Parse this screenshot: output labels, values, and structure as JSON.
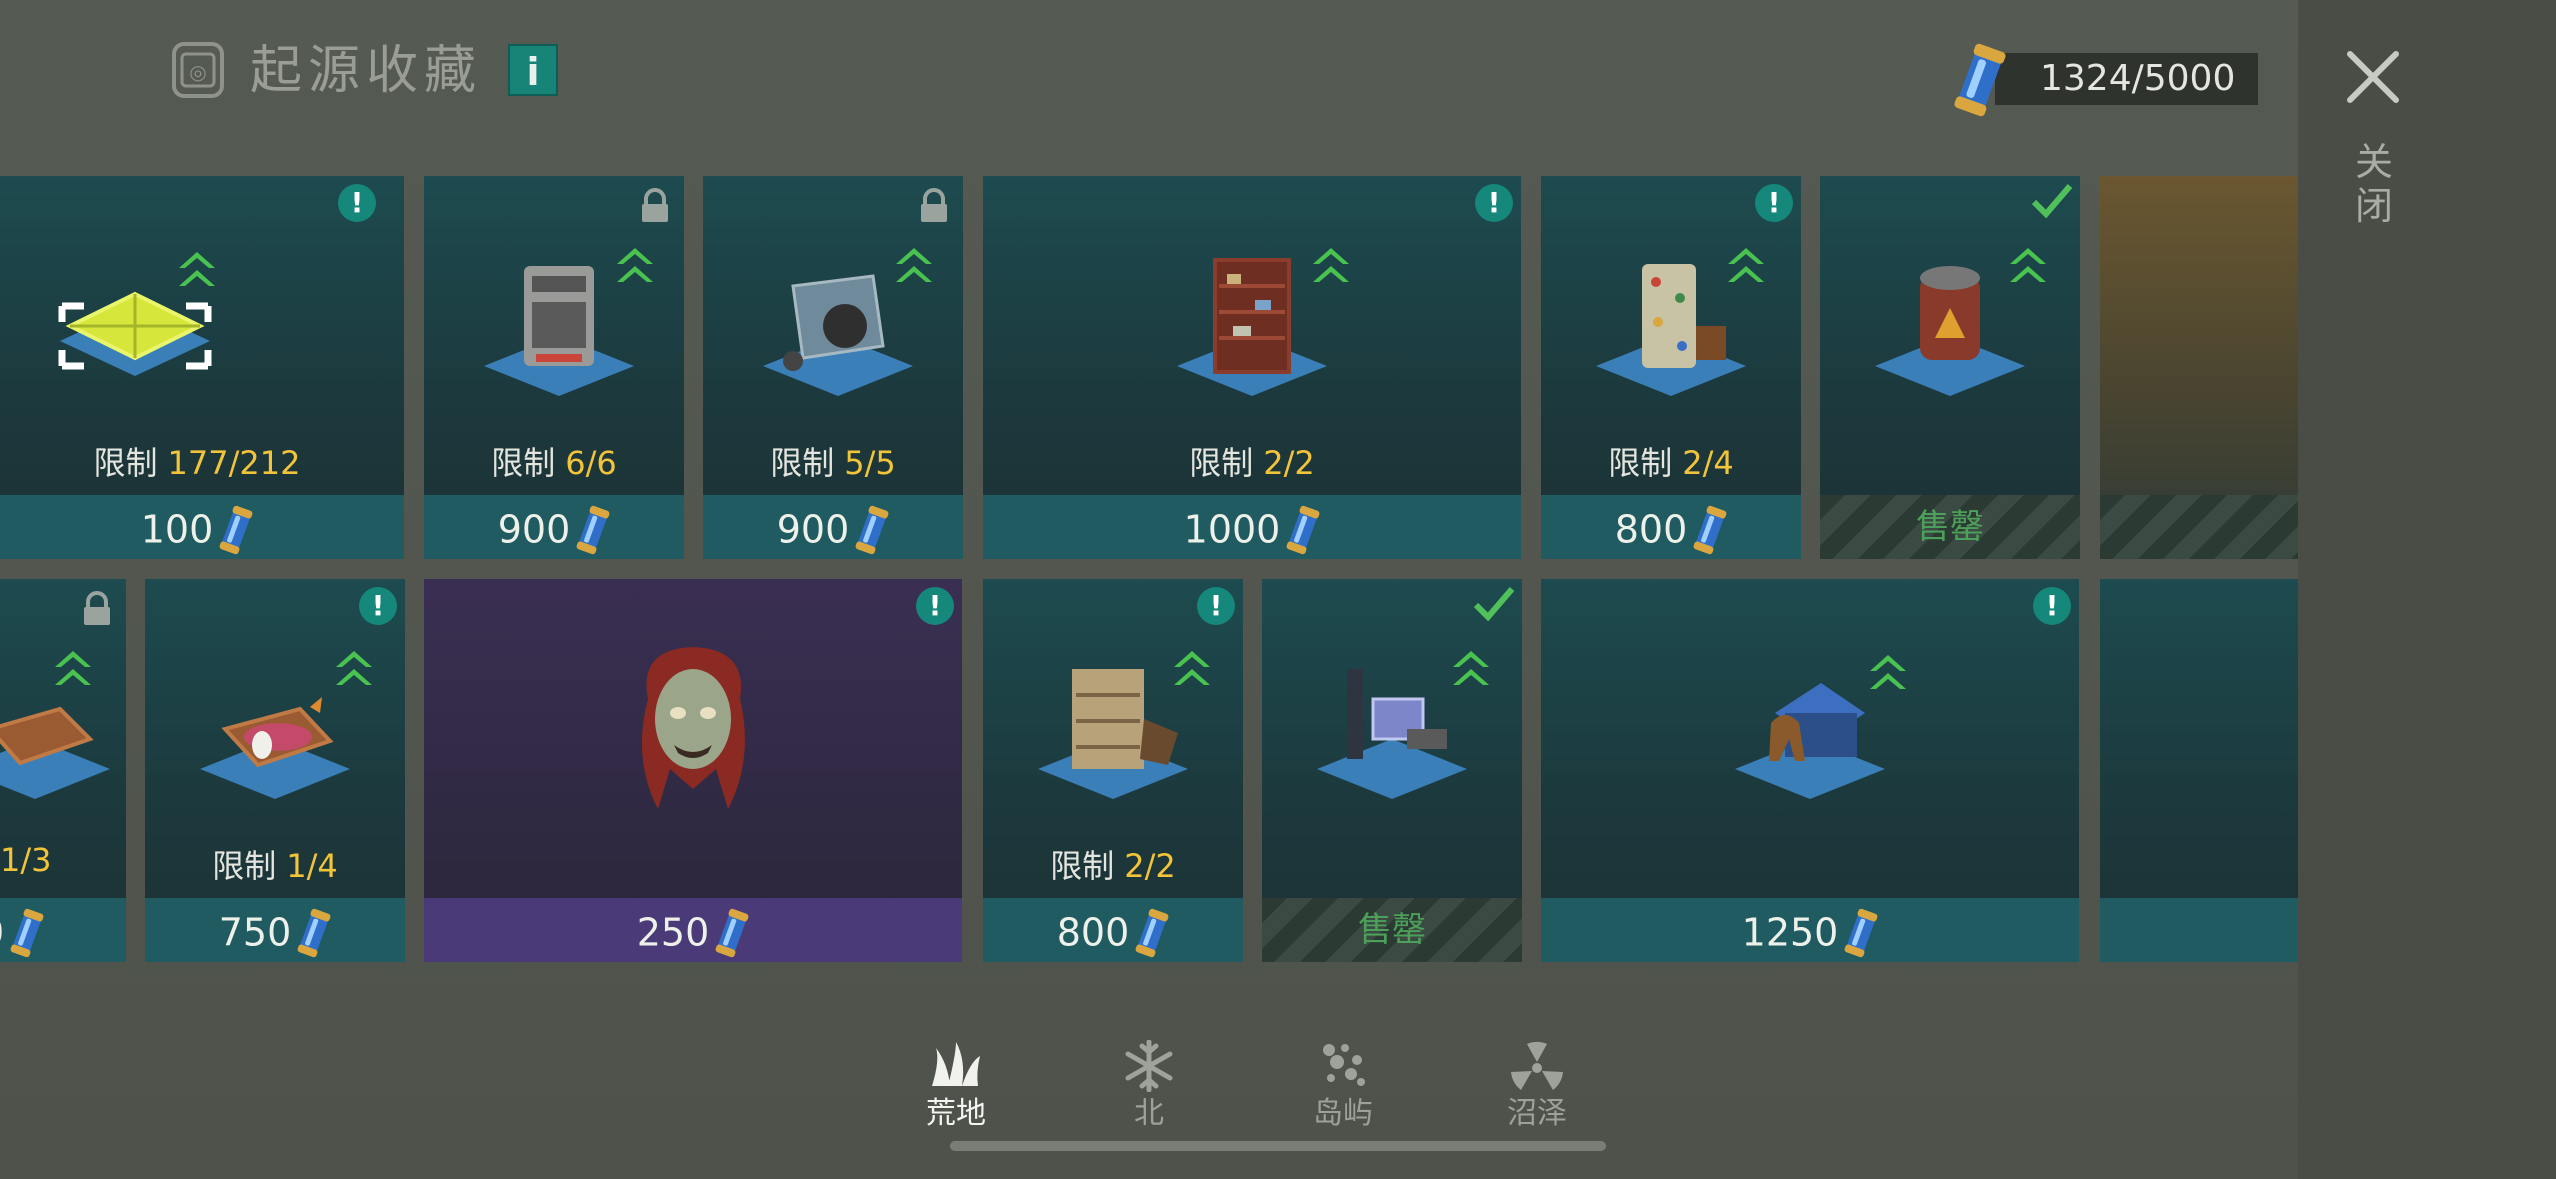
{
  "header": {
    "title": "起源收藏",
    "info_label": "i",
    "currency_value": "1324/5000",
    "close_label": "关闭"
  },
  "colors": {
    "card_teal": "#1f5b60",
    "card_purple": "#4a3b78",
    "limit_value": "#f2c43a",
    "sold_text": "#4ca05a",
    "badge": "#16877b",
    "upgrade_arrow": "#49c24f"
  },
  "row1": [
    {
      "limit_label": "限制",
      "limit_value": "177/212",
      "price": "100",
      "badge": "exclamation",
      "icon": "floor-tile-icon"
    },
    {
      "limit_label": "限制",
      "limit_value": "6/6",
      "price": "900",
      "badge": "lock",
      "icon": "oven-icon"
    },
    {
      "limit_label": "限制",
      "limit_value": "5/5",
      "price": "900",
      "badge": "lock",
      "icon": "cart-icon"
    },
    {
      "limit_label": "限制",
      "limit_value": "2/2",
      "price": "1000",
      "badge": "exclamation",
      "icon": "shelf-icon"
    },
    {
      "limit_label": "限制",
      "limit_value": "2/4",
      "price": "800",
      "badge": "exclamation",
      "icon": "climbing-wall-icon"
    },
    {
      "sold_label": "售罄",
      "badge": "check",
      "icon": "generator-icon"
    }
  ],
  "row2": [
    {
      "limit_value": "1/3",
      "price": "0",
      "badge": "lock",
      "icon": "pet-bed-icon"
    },
    {
      "limit_label": "限制",
      "limit_value": "1/4",
      "price": "750",
      "badge": "exclamation",
      "icon": "cat-bed-icon"
    },
    {
      "price": "250",
      "badge": "exclamation",
      "icon": "zombie-head-icon"
    },
    {
      "limit_label": "限制",
      "limit_value": "2/2",
      "price": "800",
      "badge": "exclamation",
      "icon": "cabinet-icon"
    },
    {
      "sold_label": "售罄",
      "badge": "check",
      "icon": "workbench-icon"
    },
    {
      "price": "1250",
      "badge": "exclamation",
      "icon": "dog-house-icon"
    }
  ],
  "nav": {
    "tabs": [
      {
        "label": "荒地",
        "icon": "wasteland-icon",
        "active": true
      },
      {
        "label": "北",
        "icon": "snowflake-icon",
        "active": false
      },
      {
        "label": "岛屿",
        "icon": "island-icon",
        "active": false
      },
      {
        "label": "沼泽",
        "icon": "radiation-icon",
        "active": false
      }
    ]
  }
}
